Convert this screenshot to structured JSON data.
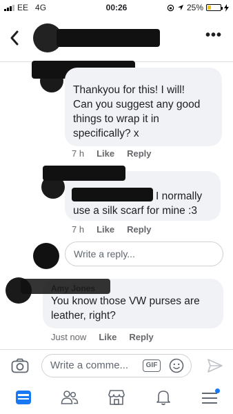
{
  "status_bar": {
    "carrier": "EE",
    "network": "4G",
    "time": "00:26",
    "battery": "25%",
    "battery_level": 0.25,
    "signal_bars_filled": 3
  },
  "header": {
    "back_icon": "chevron-left-icon",
    "more_label": "•••"
  },
  "comments": [
    {
      "author": "",
      "text_lines": [
        "Thankyou for this! I will!",
        "Can you suggest any good",
        "things to wrap it in",
        "specifically? x"
      ],
      "time": "7 h",
      "like_label": "Like",
      "reply_label": "Reply"
    },
    {
      "author": "",
      "text_lines": [
        "I normally",
        "use a silk scarf for mine :3"
      ],
      "time": "7 h",
      "like_label": "Like",
      "reply_label": "Reply"
    },
    {
      "author": "Amy Jones",
      "text_lines": [
        "You know those VW purses are",
        "leather, right?"
      ],
      "time": "Just now",
      "like_label": "Like",
      "reply_label": "Reply"
    }
  ],
  "reply_input": {
    "placeholder": "Write a reply..."
  },
  "composer": {
    "placeholder": "Write a comme...",
    "gif_label": "GIF"
  },
  "tabbar": {
    "items": [
      "news-feed-icon",
      "friends-icon",
      "marketplace-icon",
      "notifications-icon",
      "menu-icon"
    ],
    "accent": "#1877f2"
  }
}
